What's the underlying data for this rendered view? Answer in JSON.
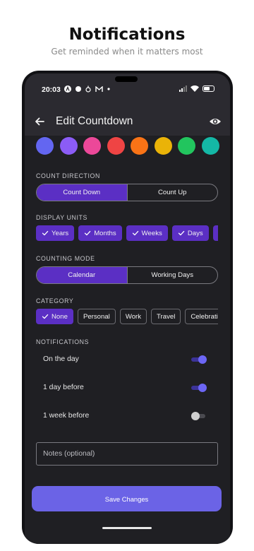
{
  "promo": {
    "title": "Notifications",
    "subtitle": "Get reminded when it matters most"
  },
  "statusbar": {
    "time": "20:03",
    "left_icons": [
      "a-icon",
      "circle-icon",
      "tooltip-icon",
      "gmail-icon",
      "dot-icon"
    ],
    "right_icons": [
      "signal-icon",
      "wifi-icon",
      "battery-icon"
    ]
  },
  "appbar": {
    "title": "Edit Countdown",
    "back_icon": "arrow-left-icon",
    "preview_icon": "eye-icon"
  },
  "colors": [
    "#6366f1",
    "#8b5cf6",
    "#ec4899",
    "#ef4444",
    "#f97316",
    "#eab308",
    "#22c55e",
    "#14b8a6"
  ],
  "count_direction": {
    "label": "COUNT DIRECTION",
    "options": [
      "Count Down",
      "Count Up"
    ],
    "selected": "Count Down"
  },
  "display_units": {
    "label": "DISPLAY UNITS",
    "options": [
      {
        "label": "Years",
        "selected": true
      },
      {
        "label": "Months",
        "selected": true
      },
      {
        "label": "Weeks",
        "selected": true
      },
      {
        "label": "Days",
        "selected": true
      }
    ]
  },
  "counting_mode": {
    "label": "COUNTING MODE",
    "options": [
      "Calendar",
      "Working Days"
    ],
    "selected": "Calendar"
  },
  "category": {
    "label": "CATEGORY",
    "options": [
      {
        "label": "None",
        "selected": true
      },
      {
        "label": "Personal",
        "selected": false
      },
      {
        "label": "Work",
        "selected": false
      },
      {
        "label": "Travel",
        "selected": false
      },
      {
        "label": "Celebration",
        "selected": false
      }
    ]
  },
  "notifications": {
    "label": "NOTIFICATIONS",
    "items": [
      {
        "label": "On the day",
        "enabled": true
      },
      {
        "label": "1 day before",
        "enabled": true
      },
      {
        "label": "1 week before",
        "enabled": false
      }
    ]
  },
  "notes": {
    "placeholder": "Notes (optional)",
    "value": ""
  },
  "save_label": "Save Changes"
}
